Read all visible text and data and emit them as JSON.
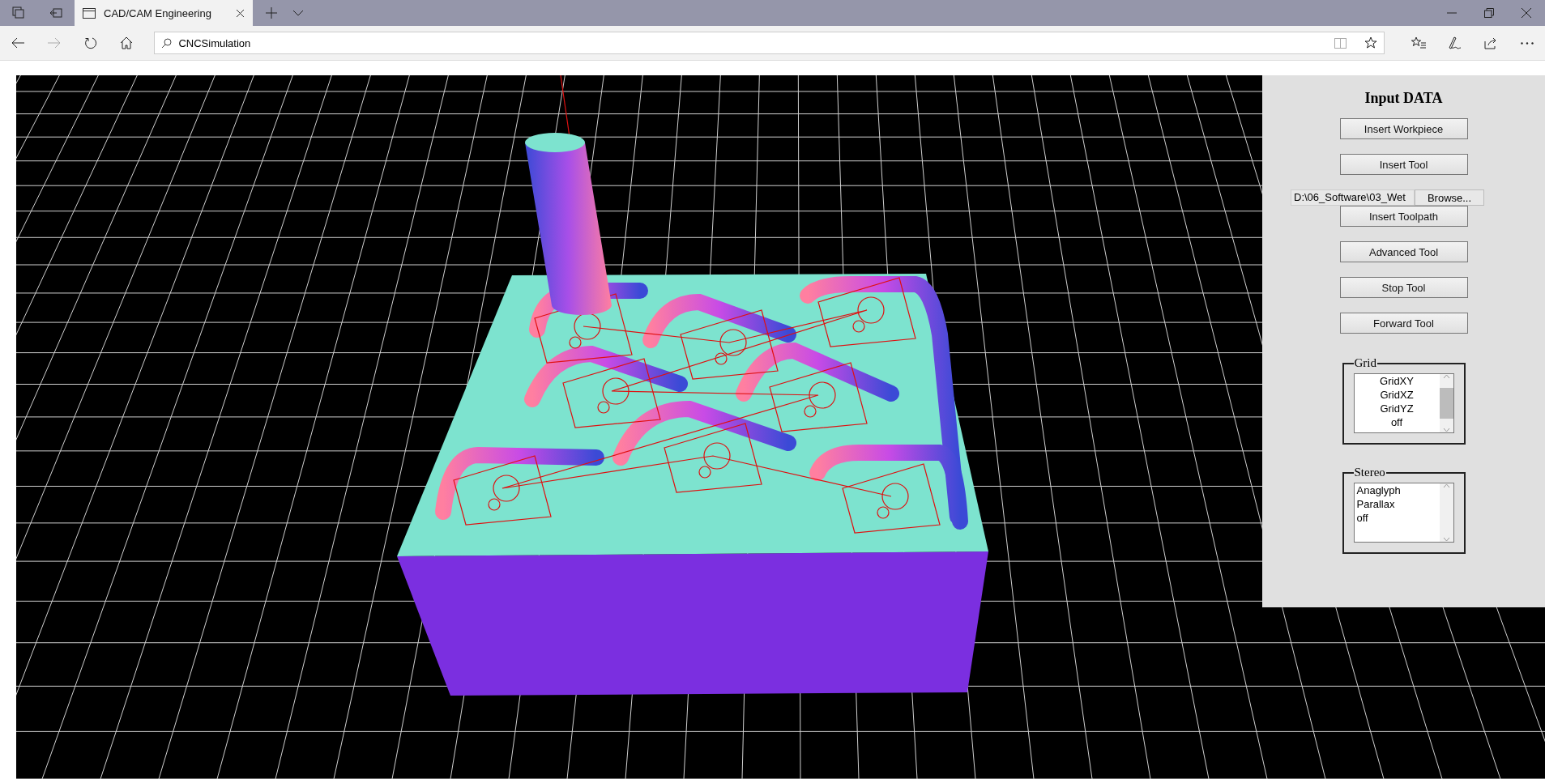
{
  "browser": {
    "tabs": [
      {
        "title": "CAD/CAM Engineering",
        "selected": true
      }
    ],
    "address": "CNCSimulation"
  },
  "panel": {
    "title": "Input DATA",
    "controls": [
      {
        "kind": "button",
        "label": "Insert Workpiece"
      },
      {
        "kind": "button",
        "label": "Insert Tool"
      },
      {
        "kind": "file",
        "value": "D:\\06_Software\\03_Wet",
        "button": "Browse..."
      },
      {
        "kind": "button",
        "label": "Insert Toolpath"
      },
      {
        "kind": "button",
        "label": "Advanced Tool"
      },
      {
        "kind": "button",
        "label": "Stop Tool"
      },
      {
        "kind": "button",
        "label": "Forward Tool"
      }
    ],
    "groups": [
      {
        "legend": "Grid",
        "kind": "centered",
        "options": [
          "GridXY",
          "GridXZ",
          "GridYZ",
          "off"
        ]
      },
      {
        "legend": "Stereo",
        "kind": "plain",
        "options": [
          "Anaglyph",
          "Parallax",
          "off"
        ]
      }
    ]
  }
}
